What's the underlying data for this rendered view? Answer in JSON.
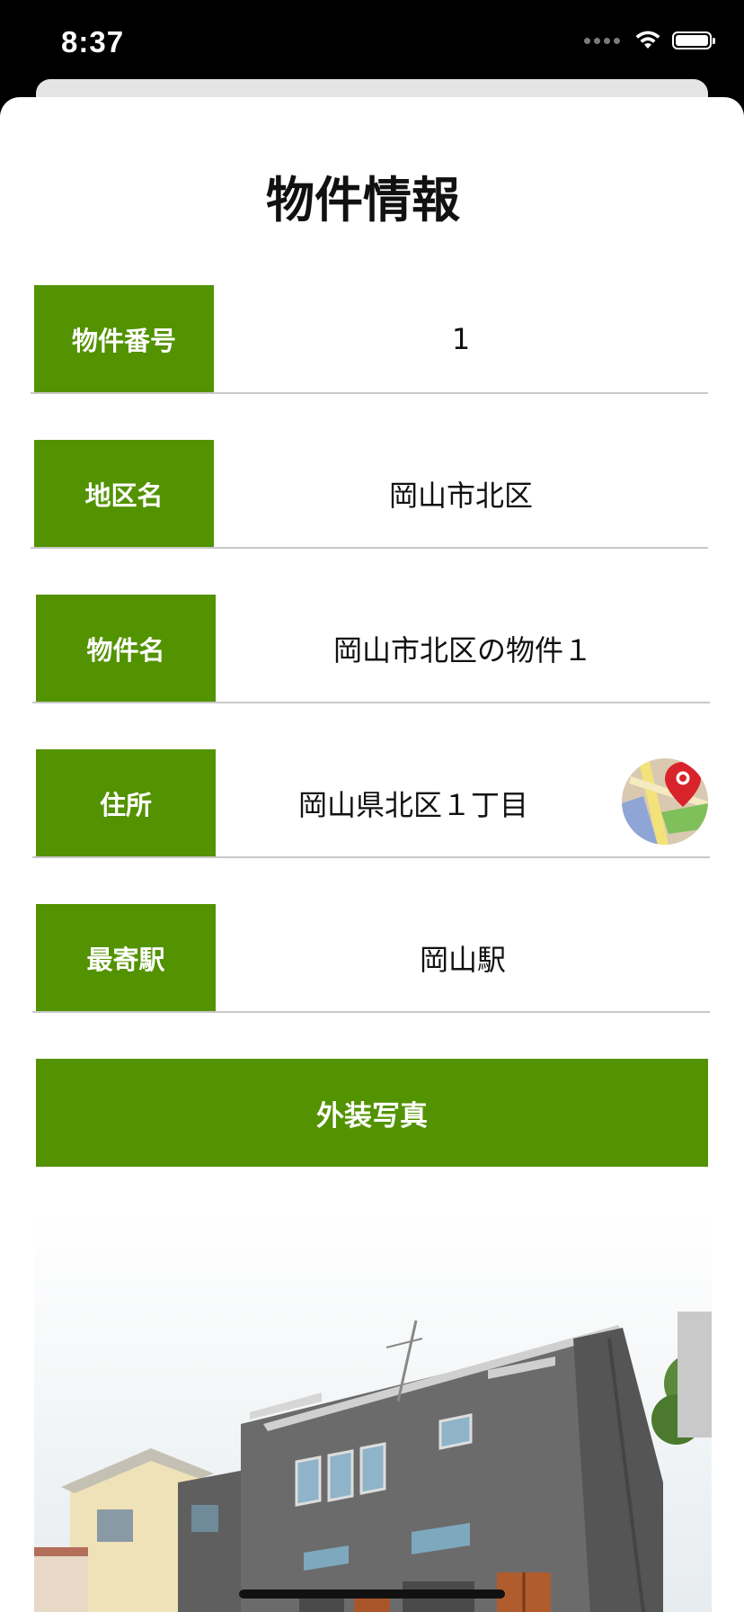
{
  "status_bar": {
    "time": "8:37"
  },
  "title": "物件情報",
  "fields": [
    {
      "label": "物件番号",
      "value": "1"
    },
    {
      "label": "地区名",
      "value": "岡山市北区"
    },
    {
      "label": "物件名",
      "value": "岡山市北区の物件１"
    },
    {
      "label": "住所",
      "value": "岡山県北区１丁目"
    },
    {
      "label": "最寄駅",
      "value": "岡山駅"
    }
  ],
  "photo_button_label": "外装写真",
  "colors": {
    "accent_green": "#539200",
    "divider": "#c8c8c8"
  },
  "icons": {
    "map": "maps-pin-icon",
    "wifi": "wifi-icon",
    "battery": "battery-icon"
  }
}
